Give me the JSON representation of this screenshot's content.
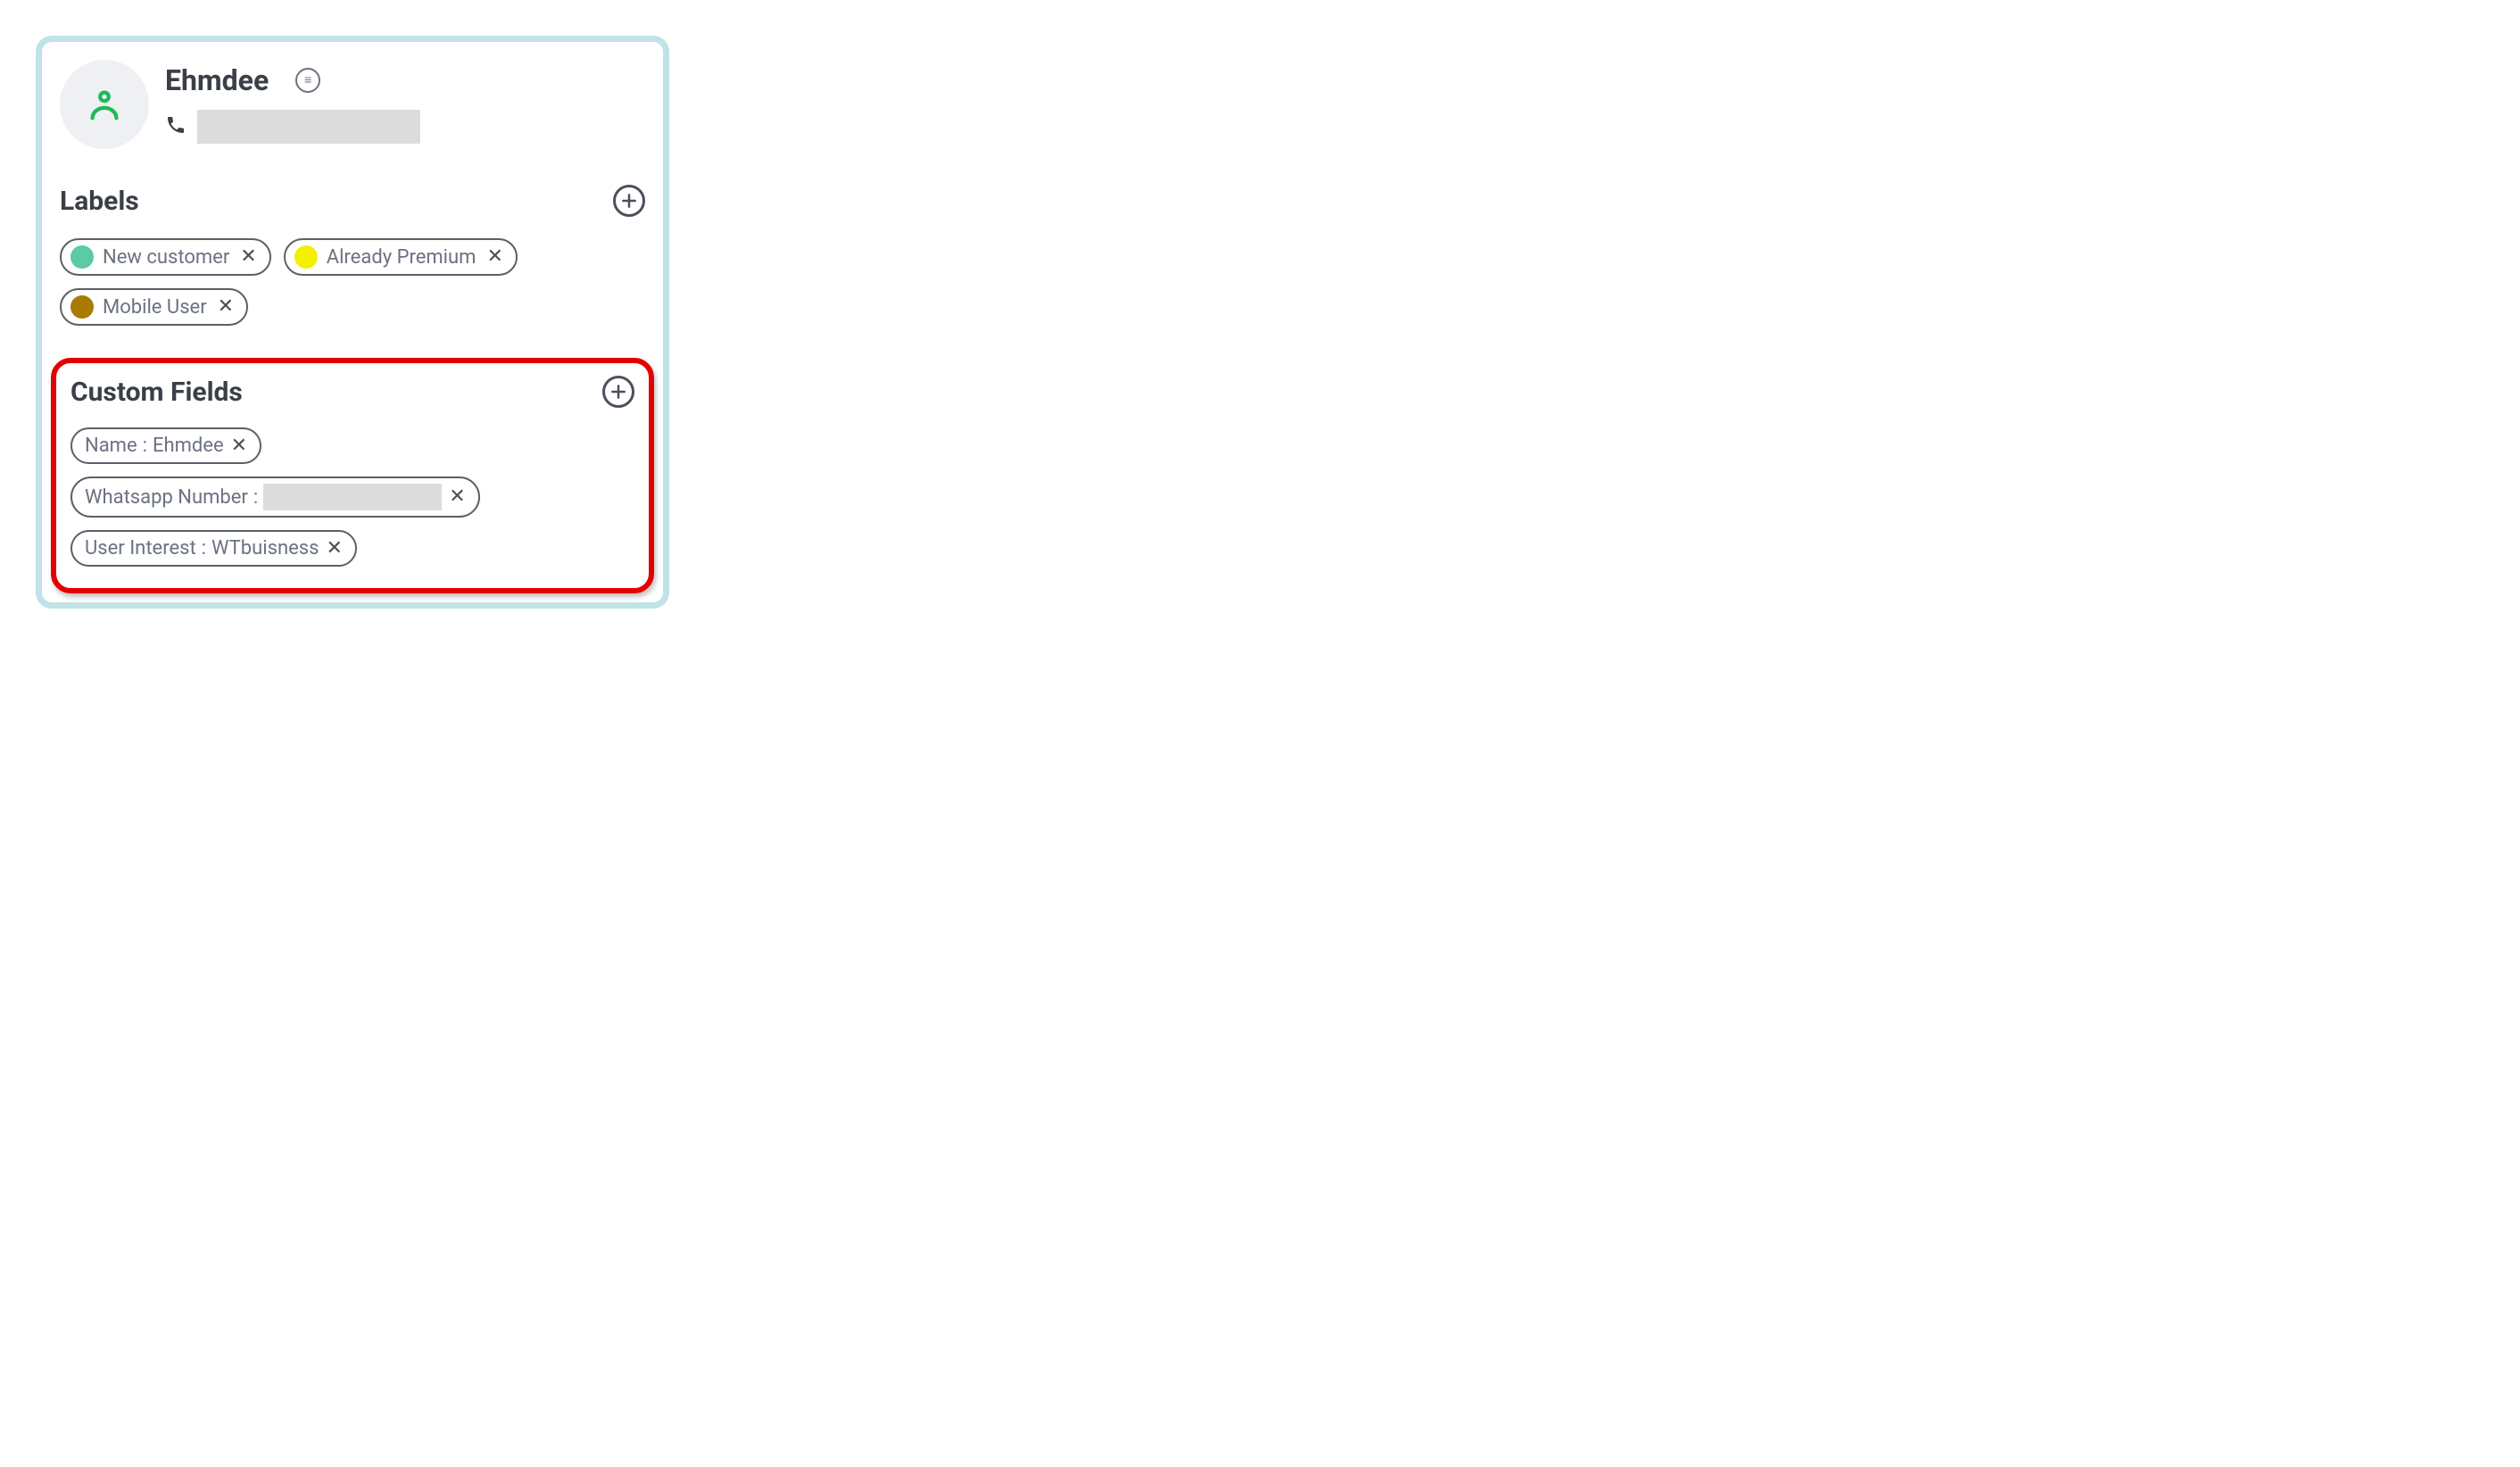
{
  "contact": {
    "name": "Ehmdee"
  },
  "labels": {
    "title": "Labels",
    "items": [
      {
        "text": "New customer",
        "color": "#5cc9a7"
      },
      {
        "text": "Already Premium",
        "color": "#f4f100"
      },
      {
        "text": "Mobile User",
        "color": "#a87a00"
      }
    ]
  },
  "custom_fields": {
    "title": "Custom Fields",
    "items": [
      {
        "key": "Name",
        "value": "Ehmdee",
        "redacted": false
      },
      {
        "key": "Whatsapp Number",
        "value": "",
        "redacted": true
      },
      {
        "key": "User Interest",
        "value": "WTbuisness",
        "redacted": false
      }
    ]
  }
}
